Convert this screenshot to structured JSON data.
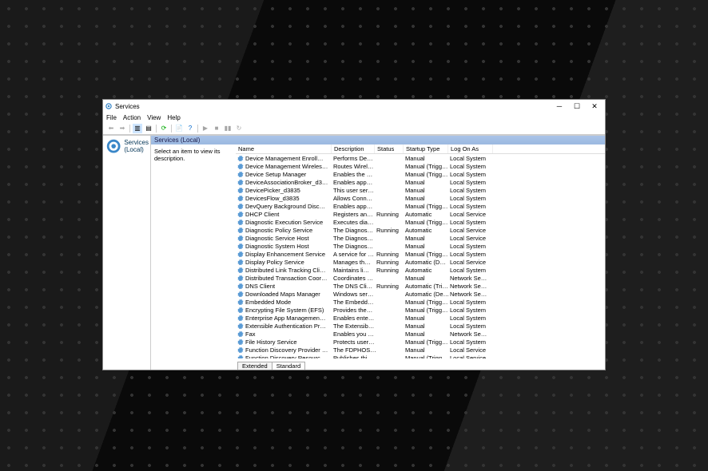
{
  "window": {
    "title": "Services"
  },
  "menu": [
    "File",
    "Action",
    "View",
    "Help"
  ],
  "tree": {
    "root": "Services (Local)"
  },
  "pane": {
    "header": "Services (Local)",
    "hint": "Select an item to view its description."
  },
  "columns": {
    "name": "Name",
    "description": "Description",
    "status": "Status",
    "startup": "Startup Type",
    "logon": "Log On As"
  },
  "tabs": {
    "extended": "Extended",
    "standard": "Standard"
  },
  "services": [
    {
      "name": "Device Management Enroll…",
      "desc": "Performs De…",
      "status": "",
      "startup": "Manual",
      "logon": "Local System"
    },
    {
      "name": "Device Management Wireles…",
      "desc": "Routes Wirel…",
      "status": "",
      "startup": "Manual (Trigg…",
      "logon": "Local System"
    },
    {
      "name": "Device Setup Manager",
      "desc": "Enables the …",
      "status": "",
      "startup": "Manual (Trigg…",
      "logon": "Local System"
    },
    {
      "name": "DeviceAssociationBroker_d3…",
      "desc": "Enables app…",
      "status": "",
      "startup": "Manual",
      "logon": "Local System"
    },
    {
      "name": "DevicePicker_d3835",
      "desc": "This user ser…",
      "status": "",
      "startup": "Manual",
      "logon": "Local System"
    },
    {
      "name": "DevicesFlow_d3835",
      "desc": "Allows Conn…",
      "status": "",
      "startup": "Manual",
      "logon": "Local System"
    },
    {
      "name": "DevQuery Background Disc…",
      "desc": "Enables app…",
      "status": "",
      "startup": "Manual (Trigg…",
      "logon": "Local System"
    },
    {
      "name": "DHCP Client",
      "desc": "Registers an…",
      "status": "Running",
      "startup": "Automatic",
      "logon": "Local Service"
    },
    {
      "name": "Diagnostic Execution Service",
      "desc": "Executes dia…",
      "status": "",
      "startup": "Manual (Trigg…",
      "logon": "Local System"
    },
    {
      "name": "Diagnostic Policy Service",
      "desc": "The Diagnos…",
      "status": "Running",
      "startup": "Automatic",
      "logon": "Local Service"
    },
    {
      "name": "Diagnostic Service Host",
      "desc": "The Diagnos…",
      "status": "",
      "startup": "Manual",
      "logon": "Local Service"
    },
    {
      "name": "Diagnostic System Host",
      "desc": "The Diagnos…",
      "status": "",
      "startup": "Manual",
      "logon": "Local System"
    },
    {
      "name": "Display Enhancement Service",
      "desc": "A service for …",
      "status": "Running",
      "startup": "Manual (Trigg…",
      "logon": "Local System"
    },
    {
      "name": "Display Policy Service",
      "desc": "Manages th…",
      "status": "Running",
      "startup": "Automatic (D…",
      "logon": "Local Service"
    },
    {
      "name": "Distributed Link Tracking Cli…",
      "desc": "Maintains li…",
      "status": "Running",
      "startup": "Automatic",
      "logon": "Local System"
    },
    {
      "name": "Distributed Transaction Coor…",
      "desc": "Coordinates …",
      "status": "",
      "startup": "Manual",
      "logon": "Network Se…"
    },
    {
      "name": "DNS Client",
      "desc": "The DNS Cli…",
      "status": "Running",
      "startup": "Automatic (Tri…",
      "logon": "Network Se…"
    },
    {
      "name": "Downloaded Maps Manager",
      "desc": "Windows ser…",
      "status": "",
      "startup": "Automatic (De…",
      "logon": "Network Se…"
    },
    {
      "name": "Embedded Mode",
      "desc": "The Embedd…",
      "status": "",
      "startup": "Manual (Trigg…",
      "logon": "Local System"
    },
    {
      "name": "Encrypting File System (EFS)",
      "desc": "Provides the…",
      "status": "",
      "startup": "Manual (Trigg…",
      "logon": "Local System"
    },
    {
      "name": "Enterprise App Managemen…",
      "desc": "Enables ente…",
      "status": "",
      "startup": "Manual",
      "logon": "Local System"
    },
    {
      "name": "Extensible Authentication Pr…",
      "desc": "The Extensib…",
      "status": "",
      "startup": "Manual",
      "logon": "Local System"
    },
    {
      "name": "Fax",
      "desc": "Enables you …",
      "status": "",
      "startup": "Manual",
      "logon": "Network Se…"
    },
    {
      "name": "File History Service",
      "desc": "Protects user…",
      "status": "",
      "startup": "Manual (Trigg…",
      "logon": "Local System"
    },
    {
      "name": "Function Discovery Provider …",
      "desc": "The FDPHOS…",
      "status": "",
      "startup": "Manual",
      "logon": "Local Service"
    },
    {
      "name": "Function Discovery Resourc…",
      "desc": "Publishes thi…",
      "status": "",
      "startup": "Manual (Trigg…",
      "logon": "Local Service"
    }
  ]
}
